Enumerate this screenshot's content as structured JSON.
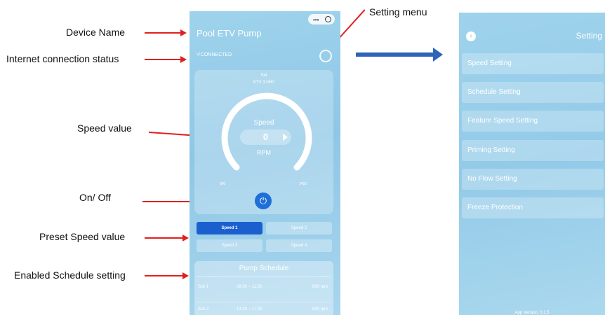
{
  "annotations": {
    "device_name": "Device Name",
    "internet_status": "Internet connection status",
    "speed_value": "Speed value",
    "on_off": "On/ Off",
    "preset_speed": "Preset Speed value",
    "enabled_schedule": "Enabled Schedule setting",
    "setting_menu": "Setting menu"
  },
  "home_screen": {
    "device_name": "Pool ETV Pump",
    "connection_status": "CONNECTED",
    "model_line1": "Sel",
    "model_line2": "ETV 3.0HP",
    "speed_label": "Speed",
    "speed_value": "0",
    "speed_unit": "RPM",
    "gauge_min": "800",
    "gauge_max": "3450",
    "presets": [
      "Speed 1",
      "Speed 2",
      "Speed 3",
      "Speed 4"
    ],
    "active_preset": "Speed 1",
    "schedule": {
      "title": "Pump Schedule",
      "rows": [
        {
          "name": "Sch 1",
          "time": "08:30 ~ 11:30",
          "rpm": "800 rpm"
        },
        {
          "name": "Sch 2",
          "time": "14:30 ~ 17:30",
          "rpm": "800 rpm"
        }
      ]
    }
  },
  "settings_screen": {
    "title": "Setting",
    "items": [
      "Speed Setting",
      "Schedule Setting",
      "Feature Speed Setting",
      "Priming Setting",
      "No Flow Setting",
      "Freeze Protection"
    ],
    "app_version": "App Version: 0.1.5"
  },
  "icons": {
    "wifi": "wifi-icon",
    "settings": "gear-icon",
    "power": "power-icon",
    "back": "back-chevron-icon"
  },
  "colors": {
    "accent_blue": "#1e6fd8",
    "annotation_red": "#e02020",
    "flow_arrow_blue": "#2f63b8"
  }
}
